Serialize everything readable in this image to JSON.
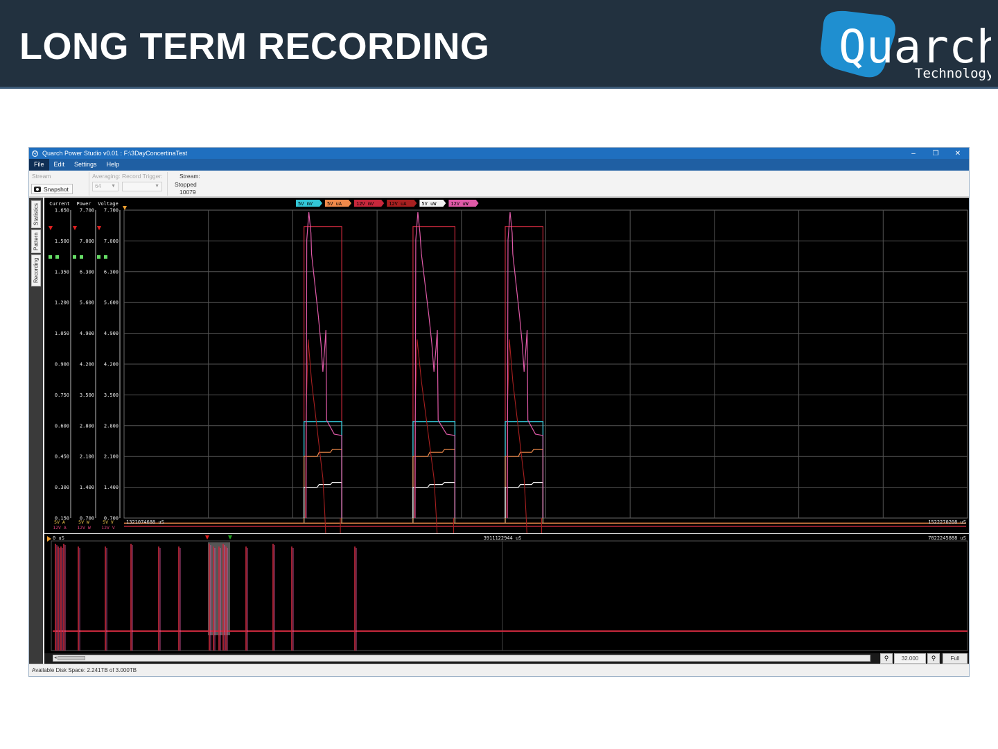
{
  "slide": {
    "title": "LONG TERM RECORDING",
    "logo_text": "Quarch",
    "logo_subtext": "Technology",
    "logo_color": "#1f8fd0"
  },
  "window": {
    "title": "Quarch Power Studio v0.01 : F:\\3DayConcertinaTest",
    "controls": [
      "–",
      "❐",
      "✕"
    ]
  },
  "menu": {
    "items": [
      "File",
      "Edit",
      "Settings",
      "Help"
    ],
    "active": "File"
  },
  "toolbar": {
    "stream_button": "Stream",
    "snapshot_button": "Snapshot",
    "averaging_label": "Averaging:",
    "averaging_value": "64",
    "record_trigger_label": "Record Trigger:",
    "record_trigger_value": "",
    "stream_label": "Stream:",
    "stream_status": "Stopped",
    "stream_count": "10079"
  },
  "sidetabs": [
    "Statistics",
    "Pattern",
    "Recording"
  ],
  "axes": {
    "current_title": "Current",
    "power_title": "Power",
    "voltage_title": "Voltage",
    "current_ticks": [
      "1.650",
      "1.500",
      "1.350",
      "1.200",
      "1.050",
      "0.900",
      "0.750",
      "0.600",
      "0.450",
      "0.300",
      "0.150"
    ],
    "power_ticks": [
      "7.700",
      "7.000",
      "6.300",
      "5.600",
      "4.900",
      "4.200",
      "3.500",
      "2.800",
      "2.100",
      "1.400",
      "0.700"
    ],
    "voltage_ticks": [
      "7.700",
      "7.000",
      "6.300",
      "5.600",
      "4.900",
      "4.200",
      "3.500",
      "2.800",
      "2.100",
      "1.400",
      "0.700"
    ],
    "current_units": [
      "5V A",
      "12V A"
    ],
    "power_units": [
      "5V W",
      "12V W"
    ],
    "voltage_units": [
      "5V V",
      "12V V"
    ]
  },
  "legend": [
    {
      "label": "5V mV",
      "color": "#33c6d6"
    },
    {
      "label": "5V uA",
      "color": "#f08a4b"
    },
    {
      "label": "12V mV",
      "color": "#c8283c"
    },
    {
      "label": "12V uA",
      "color": "#a82020"
    },
    {
      "label": "5V uW",
      "color": "#f2f2f2"
    },
    {
      "label": "12V uW",
      "color": "#e05aa8"
    }
  ],
  "main_time": {
    "start": "1321074688 uS",
    "end": "1522270208 uS"
  },
  "overview_time": {
    "start": "0 uS",
    "mid": "3911122944 uS",
    "end": "7822245888 uS"
  },
  "zoom": {
    "value": "32.000",
    "full_label": "Full"
  },
  "status": {
    "disk": "Available Disk Space: 2.241TB of 3.000TB"
  },
  "chart_data": {
    "type": "line",
    "x_unit": "uS",
    "xlim": [
      1321074688,
      1522270208
    ],
    "bursts": [
      {
        "start": 1364000000,
        "end": 1373000000
      },
      {
        "start": 1390000000,
        "end": 1400000000
      },
      {
        "start": 1412000000,
        "end": 1421000000
      }
    ],
    "series": [
      {
        "name": "5V mV",
        "idle": 0.125,
        "active": 0.62
      },
      {
        "name": "5V uA",
        "idle": 0.125,
        "active": 0.45
      },
      {
        "name": "12V mV",
        "idle": 0.11,
        "active": 1.57
      },
      {
        "name": "12V uA",
        "idle": 0.11,
        "active": 1.02
      },
      {
        "name": "5V uW",
        "idle": 0.0,
        "active": 0.3
      },
      {
        "name": "12V uW",
        "idle": 0.0,
        "active": 1.64
      }
    ],
    "ylim": [
      0.15,
      1.65
    ]
  }
}
